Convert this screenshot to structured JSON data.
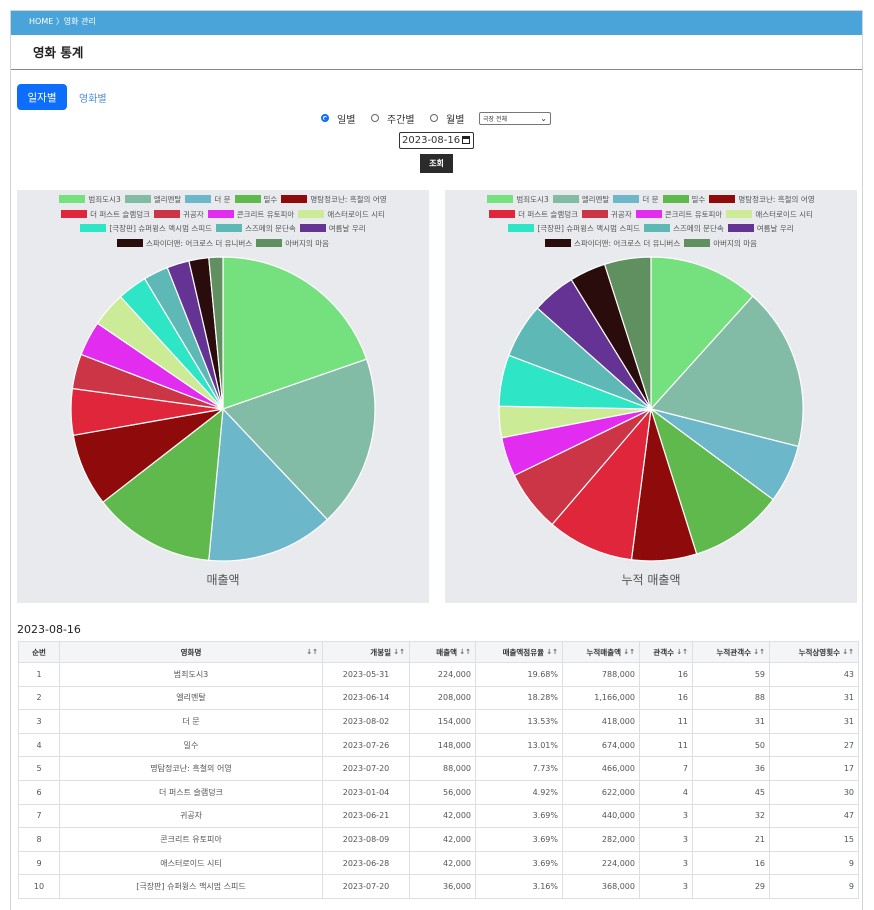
{
  "breadcrumb": "HOME 〉영화 관리",
  "page_title": "영화 통계",
  "tabs": {
    "daily": "일자별",
    "movie": "영화별"
  },
  "filters": {
    "radios": [
      {
        "label": "일별",
        "checked": true
      },
      {
        "label": "주간별",
        "checked": false
      },
      {
        "label": "월별",
        "checked": false
      }
    ],
    "theater_select": "극장 전체",
    "date": "2023-08-16",
    "search_button": "조회"
  },
  "legend": [
    {
      "name": "범죄도시3",
      "color": "#74e07e"
    },
    {
      "name": "엘리멘탈",
      "color": "#82bca6"
    },
    {
      "name": "더 문",
      "color": "#6db7cb"
    },
    {
      "name": "밀수",
      "color": "#5fb94c"
    },
    {
      "name": "명탐정코난: 흑철의 어영",
      "color": "#8f0b0b"
    },
    {
      "name": "더 퍼스트 슬램덩크",
      "color": "#e0263b"
    },
    {
      "name": "귀공자",
      "color": "#cb3545"
    },
    {
      "name": "콘크리트 유토피아",
      "color": "#e22cf0"
    },
    {
      "name": "애스터로이드 시티",
      "color": "#cceb96"
    },
    {
      "name": "[극장판] 슈퍼윙스 맥시멈 스피드",
      "color": "#2ee6c6"
    },
    {
      "name": "스즈메의 문단속",
      "color": "#5db8b6"
    },
    {
      "name": "여름날 우리",
      "color": "#643394"
    },
    {
      "name": "스파이더맨: 어크로스 더 유니버스",
      "color": "#2b0c0c"
    },
    {
      "name": "아버지의 마음",
      "color": "#619060"
    }
  ],
  "chart_data": [
    {
      "type": "pie",
      "title": "매출액",
      "labels": [
        "범죄도시3",
        "엘리멘탈",
        "더 문",
        "밀수",
        "명탐정코난: 흑철의 어영",
        "더 퍼스트 슬램덩크",
        "귀공자",
        "콘크리트 유토피아",
        "애스터로이드 시티",
        "[극장판] 슈퍼윙스 맥시멈 스피드",
        "스즈메의 문단속",
        "여름날 우리",
        "스파이더맨: 어크로스 더 유니버스",
        "아버지의 마음"
      ],
      "values": [
        224000,
        208000,
        154000,
        148000,
        88000,
        56000,
        42000,
        42000,
        42000,
        36000,
        30000,
        27000,
        24000,
        17000
      ]
    },
    {
      "type": "pie",
      "title": "누적 매출액",
      "labels": [
        "범죄도시3",
        "엘리멘탈",
        "더 문",
        "밀수",
        "명탐정코난: 흑철의 어영",
        "더 퍼스트 슬램덩크",
        "귀공자",
        "콘크리트 유토피아",
        "애스터로이드 시티",
        "[극장판] 슈퍼윙스 맥시멈 스피드",
        "스즈메의 문단속",
        "여름날 우리",
        "스파이더맨: 어크로스 더 유니버스",
        "아버지의 마음"
      ],
      "values": [
        788000,
        1166000,
        418000,
        674000,
        466000,
        622000,
        440000,
        282000,
        224000,
        368000,
        392000,
        314000,
        260000,
        333000
      ]
    }
  ],
  "table": {
    "date_label": "2023-08-16",
    "headers": [
      "순번",
      "영화명",
      "개봉일",
      "매출액",
      "매출액점유율",
      "누적매출액",
      "관객수",
      "누적관객수",
      "누적상영횟수"
    ],
    "rows": [
      [
        "1",
        "범죄도시3",
        "2023-05-31",
        "224,000",
        "19.68%",
        "788,000",
        "16",
        "59",
        "43"
      ],
      [
        "2",
        "엘리멘탈",
        "2023-06-14",
        "208,000",
        "18.28%",
        "1,166,000",
        "16",
        "88",
        "31"
      ],
      [
        "3",
        "더 문",
        "2023-08-02",
        "154,000",
        "13.53%",
        "418,000",
        "11",
        "31",
        "31"
      ],
      [
        "4",
        "밀수",
        "2023-07-26",
        "148,000",
        "13.01%",
        "674,000",
        "11",
        "50",
        "27"
      ],
      [
        "5",
        "명탐정코난: 흑철의 어영",
        "2023-07-20",
        "88,000",
        "7.73%",
        "466,000",
        "7",
        "36",
        "17"
      ],
      [
        "6",
        "더 퍼스트 슬램덩크",
        "2023-01-04",
        "56,000",
        "4.92%",
        "622,000",
        "4",
        "45",
        "30"
      ],
      [
        "7",
        "귀공자",
        "2023-06-21",
        "42,000",
        "3.69%",
        "440,000",
        "3",
        "32",
        "47"
      ],
      [
        "8",
        "콘크리트 유토피아",
        "2023-08-09",
        "42,000",
        "3.69%",
        "282,000",
        "3",
        "21",
        "15"
      ],
      [
        "9",
        "애스터로이드 시티",
        "2023-06-28",
        "42,000",
        "3.69%",
        "224,000",
        "3",
        "16",
        "9"
      ],
      [
        "10",
        "[극장판] 슈퍼윙스 맥시멈 스피드",
        "2023-07-20",
        "36,000",
        "3.16%",
        "368,000",
        "3",
        "29",
        "9"
      ]
    ]
  }
}
